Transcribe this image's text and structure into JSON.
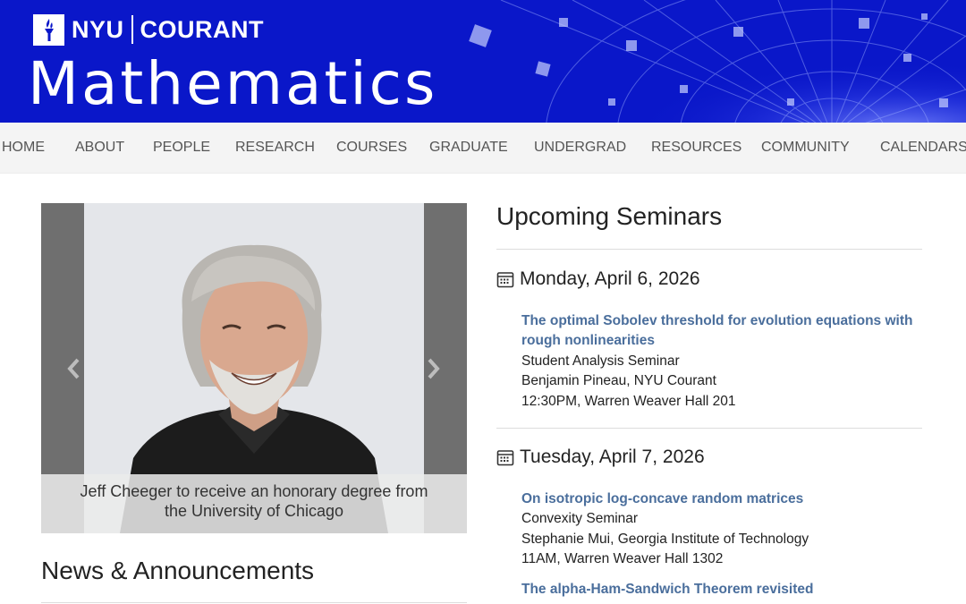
{
  "header": {
    "brand_nyu": "NYU",
    "brand_courant": "COURANT",
    "site_title": "Mathematics",
    "colors": {
      "banner_bg": "#0a17c9",
      "link": "#4a6e9c"
    },
    "logo_icon": "nyu-torch-icon"
  },
  "nav": {
    "items": [
      "HOME",
      "ABOUT",
      "PEOPLE",
      "RESEARCH",
      "COURSES",
      "GRADUATE",
      "UNDERGRAD",
      "RESOURCES",
      "COMMUNITY",
      "CALENDARS"
    ]
  },
  "carousel": {
    "caption": "Jeff Cheeger to receive an honorary degree from the University of Chicago",
    "prev_icon": "chevron-left-icon",
    "next_icon": "chevron-right-icon"
  },
  "news": {
    "title": "News & Announcements"
  },
  "seminars": {
    "title": "Upcoming Seminars",
    "days": [
      {
        "date": "Monday, April 6, 2026",
        "events": [
          {
            "title": "The optimal Sobolev threshold for evolution equations with rough nonlinearities",
            "seminar": "Student Analysis Seminar",
            "speaker": "Benjamin Pineau, NYU Courant",
            "time_place": "12:30PM, Warren Weaver Hall 201"
          }
        ]
      },
      {
        "date": "Tuesday, April 7, 2026",
        "events": [
          {
            "title": "On isotropic log-concave random matrices",
            "seminar": "Convexity Seminar",
            "speaker": "Stephanie Mui, Georgia Institute of Technology",
            "time_place": "11AM, Warren Weaver Hall 1302"
          },
          {
            "title": "The alpha-Ham-Sandwich Theorem revisited"
          }
        ]
      }
    ]
  }
}
